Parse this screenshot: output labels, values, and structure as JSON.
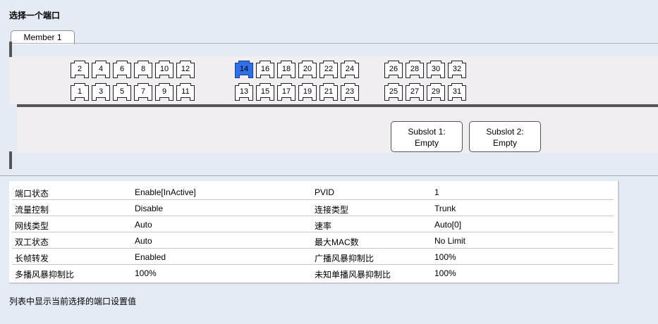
{
  "heading": "选择一个端口",
  "member_tab": "Member 1",
  "ports": {
    "group1_top": [
      "2",
      "4",
      "6",
      "8",
      "10",
      "12"
    ],
    "group1_bottom": [
      "1",
      "3",
      "5",
      "7",
      "9",
      "11"
    ],
    "group2_top": [
      "14",
      "16",
      "18",
      "20",
      "22",
      "24"
    ],
    "group2_bottom": [
      "13",
      "15",
      "17",
      "19",
      "21",
      "23"
    ],
    "group3_top": [
      "26",
      "28",
      "30",
      "32"
    ],
    "group3_bottom": [
      "25",
      "27",
      "29",
      "31"
    ],
    "selected": "14"
  },
  "subslots": [
    {
      "line1": "Subslot 1:",
      "line2": "Empty"
    },
    {
      "line1": "Subslot 2:",
      "line2": "Empty"
    }
  ],
  "info_rows": [
    {
      "label1": "端口状态",
      "value1": "Enable[InActive]",
      "label2": "PVID",
      "value2": "1"
    },
    {
      "label1": "流量控制",
      "value1": "Disable",
      "label2": "连接类型",
      "value2": "Trunk"
    },
    {
      "label1": "网线类型",
      "value1": "Auto",
      "label2": "速率",
      "value2": "Auto[0]"
    },
    {
      "label1": "双工状态",
      "value1": "Auto",
      "label2": "最大MAC数",
      "value2": "No Limit"
    },
    {
      "label1": "长帧转发",
      "value1": "Enabled",
      "label2": "广播风暴抑制比",
      "value2": "100%"
    },
    {
      "label1": "多播风暴抑制比",
      "value1": "100%",
      "label2": "未知单播风暴抑制比",
      "value2": "100%"
    }
  ],
  "footer_note": "列表中显示当前选择的端口设置值",
  "colors": {
    "background": "#e4ebf5",
    "selected_port": "#2f6fe8",
    "panel": "#f1eef2"
  }
}
